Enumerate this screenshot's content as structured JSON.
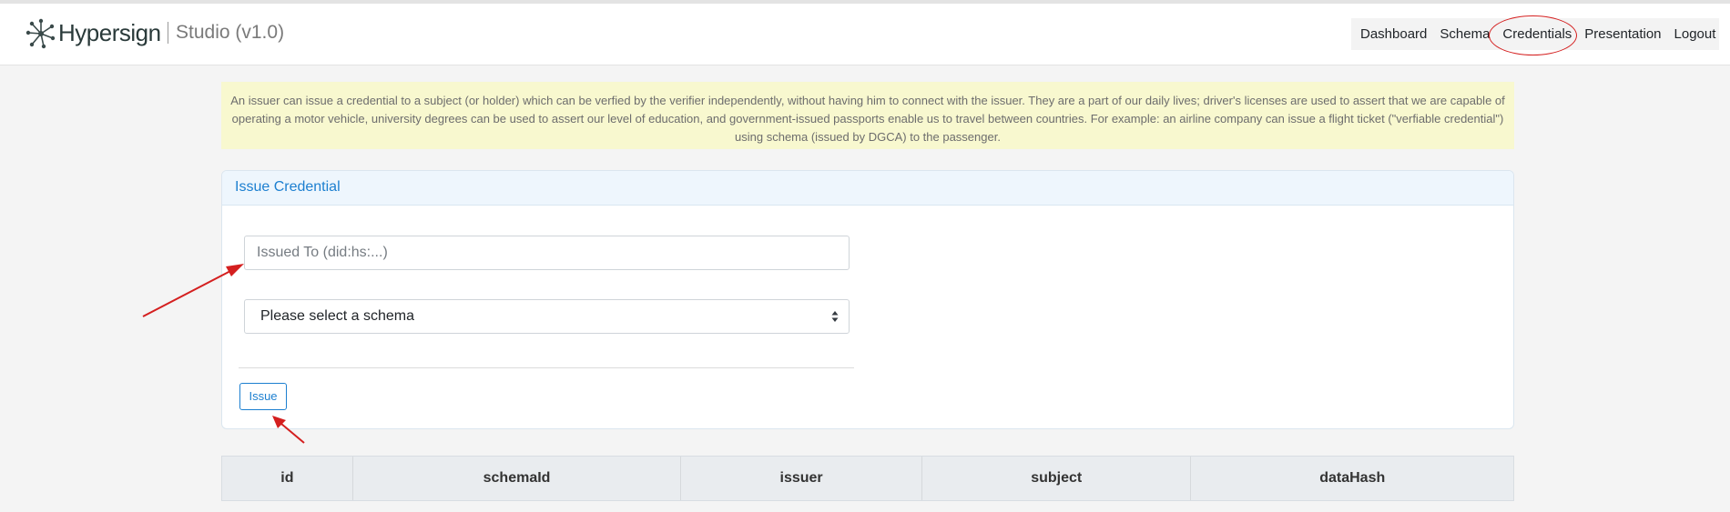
{
  "brand": {
    "name": "Hypersign",
    "subtitle": "Studio (v1.0)"
  },
  "nav": {
    "items": [
      {
        "label": "Dashboard"
      },
      {
        "label": "Schema"
      },
      {
        "label": "Credentials"
      },
      {
        "label": "Presentation"
      },
      {
        "label": "Logout"
      }
    ],
    "active": "Credentials"
  },
  "info_text": "An issuer can issue a credential to a subject (or holder) which can be verfied by the verifier independently, without having him to connect with the issuer. They are a part of our daily lives; driver's licenses are used to assert that we are capable of operating a motor vehicle, university degrees can be used to assert our level of education, and government-issued passports enable us to travel between countries. For example: an airline company can issue a flight ticket (\"verfiable credential\") using schema (issued by DGCA) to the passenger.",
  "card": {
    "title": "Issue Credential",
    "issued_to_placeholder": "Issued To (did:hs:...)",
    "issued_to_value": "",
    "schema_selected": "Please select a schema",
    "issue_label": "Issue"
  },
  "table": {
    "headers": [
      "id",
      "schemaId",
      "issuer",
      "subject",
      "dataHash"
    ]
  },
  "colors": {
    "accent": "#1c7fd0",
    "annotation": "#d41f1f",
    "info_bg": "#f8f8cf"
  }
}
